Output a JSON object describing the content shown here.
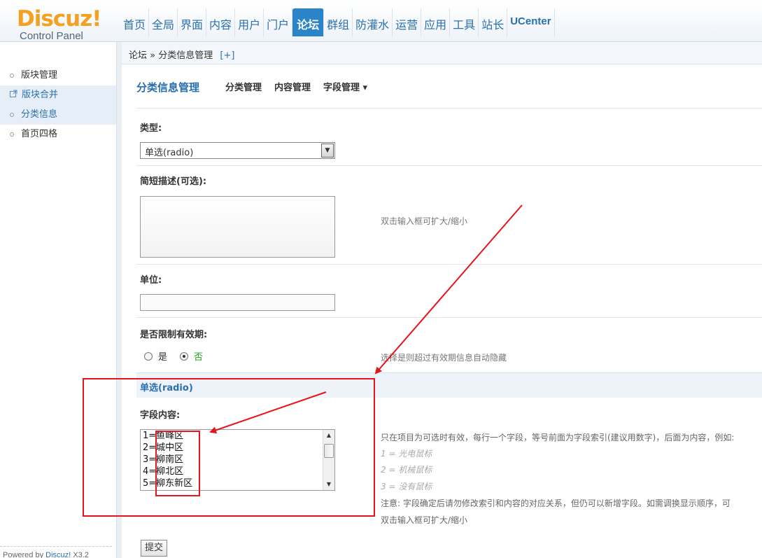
{
  "logo": {
    "main": "Discuz!",
    "sub": "Control Panel"
  },
  "nav": {
    "items": [
      {
        "label": "首页"
      },
      {
        "label": "全局"
      },
      {
        "label": "界面"
      },
      {
        "label": "内容"
      },
      {
        "label": "用户"
      },
      {
        "label": "门户"
      },
      {
        "label": "论坛",
        "active": true
      },
      {
        "label": "群组"
      },
      {
        "label": "防灌水"
      },
      {
        "label": "运营"
      },
      {
        "label": "应用"
      },
      {
        "label": "工具"
      },
      {
        "label": "站长"
      },
      {
        "label": "UCenter"
      }
    ]
  },
  "breadcrumb": {
    "root": "论坛",
    "sep": "»",
    "current": "分类信息管理",
    "add": "[+]"
  },
  "sidebar": {
    "items": [
      {
        "label": "版块管理"
      },
      {
        "label": "版块合并"
      },
      {
        "label": "分类信息"
      },
      {
        "label": "首页四格"
      }
    ],
    "powered_prefix": "Powered by ",
    "powered_link": "Discuz!",
    "powered_version": " X3.2"
  },
  "main": {
    "title": "分类信息管理",
    "tabs": [
      "分类管理",
      "内容管理",
      "字段管理 ▾"
    ],
    "type_label": "类型:",
    "type_value": "单选(radio)",
    "desc_label": "简短描述(可选):",
    "desc_hint": "双击输入框可扩大/缩小",
    "unit_label": "单位:",
    "unit_value": "",
    "expire_label": "是否限制有效期:",
    "expire_yes": "是",
    "expire_no": "否",
    "expire_selected": "否",
    "expire_hint": "选择是则超过有效期信息自动隐藏",
    "section_title": "单选(radio)",
    "choices_label": "字段内容:",
    "choices": [
      "1=鱼峰区",
      "2=城中区",
      "3=柳南区",
      "4=柳北区",
      "5=柳东新区"
    ],
    "help_line1": "只在项目为可选时有效，每行一个字段，等号前面为字段索引(建议用数字)，后面为内容，例如:",
    "help_examples": [
      "1 = 光电鼠标",
      "2 = 机械鼠标",
      "3 = 没有鼠标"
    ],
    "help_note": "注意: 字段确定后请勿修改索引和内容的对应关系，但仍可以新增字段。如需调换显示顺序，可",
    "help_dblclick": "双击输入框可扩大/缩小",
    "submit_label": "提交"
  },
  "colors": {
    "accent": "#2b84c7",
    "logo": "#f6a022",
    "annotation": "#e8141c"
  }
}
